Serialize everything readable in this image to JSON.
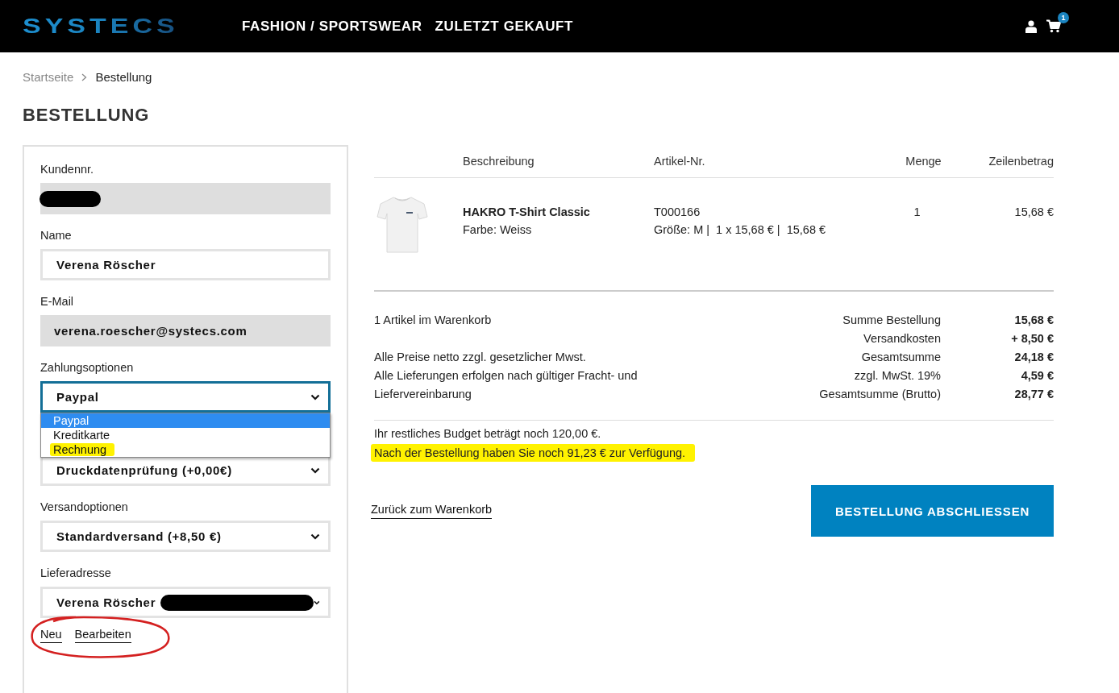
{
  "header": {
    "logo": "SYSTECS",
    "nav": [
      {
        "label": "FASHION / SPORTSWEAR"
      },
      {
        "label": "ZULETZT GEKAUFT"
      }
    ],
    "cart_count": "1"
  },
  "breadcrumb": [
    {
      "label": "Startseite",
      "current": false
    },
    {
      "label": "Bestellung",
      "current": true
    }
  ],
  "title": "BESTELLUNG",
  "form": {
    "fields": [
      {
        "kind": "readonly",
        "label": "Kundennr.",
        "redacted": true
      },
      {
        "kind": "input",
        "label": "Name",
        "value": "Verena Röscher"
      },
      {
        "kind": "readonly",
        "label": "E-Mail",
        "value": "verena.roescher@systecs.com"
      },
      {
        "kind": "select",
        "label": "Zahlungsoptionen",
        "value": "Paypal",
        "open": true,
        "options": [
          {
            "label": "Paypal",
            "selected": true,
            "highlighted": false
          },
          {
            "label": "Kreditkarte",
            "selected": false,
            "highlighted": false
          },
          {
            "label": "Rechnung",
            "selected": false,
            "highlighted": true
          }
        ]
      },
      {
        "kind": "select",
        "value": "Druckdatenprüfung (+0,00€)"
      },
      {
        "kind": "select",
        "label": "Versandoptionen",
        "value": "Standardversand (+8,50 €)"
      },
      {
        "kind": "select",
        "label": "Lieferadresse",
        "value": "Verena Röscher",
        "redacted": true
      }
    ],
    "links": [
      {
        "label": "Neu"
      },
      {
        "label": "Bearbeiten"
      }
    ],
    "links_circled": true
  },
  "cart": {
    "columns": [
      "Beschreibung",
      "Artikel-Nr.",
      "Menge",
      "Zeilenbetrag"
    ],
    "rows": [
      {
        "name": "HAKRO T-Shirt Classic",
        "variant": "Farbe: Weiss",
        "article_no": "T000166",
        "details": "Größe: M |  1 x 15,68 € |  15,68 €",
        "quantity": "1",
        "amount": "15,68 €"
      }
    ]
  },
  "summary": {
    "count": "1 Artikel im Warenkorb",
    "notes": [
      "Alle Preise netto zzgl. gesetzlicher Mwst.",
      "Alle Lieferungen erfolgen nach gültiger Fracht- und Liefervereinbarung"
    ],
    "totals": [
      {
        "label": "Summe Bestellung",
        "value": "15,68 €"
      },
      {
        "label": "Versandkosten",
        "value": "+ 8,50 €"
      },
      {
        "label": "Gesamtsumme",
        "value": "24,18 €"
      },
      {
        "label": "zzgl. MwSt. 19%",
        "value": "4,59 €"
      },
      {
        "label": "Gesamtsumme (Brutto)",
        "value": "28,77 €"
      }
    ]
  },
  "budget": [
    {
      "text": "Ihr restliches Budget beträgt noch 120,00 €.",
      "highlighted": false
    },
    {
      "text": "Nach der Bestellung haben Sie noch 91,23 € zur Verfügung.",
      "highlighted": true
    }
  ],
  "back_link": "Zurück zum Warenkorb",
  "submit_button": "BESTELLUNG ABSCHLIESSEN"
}
